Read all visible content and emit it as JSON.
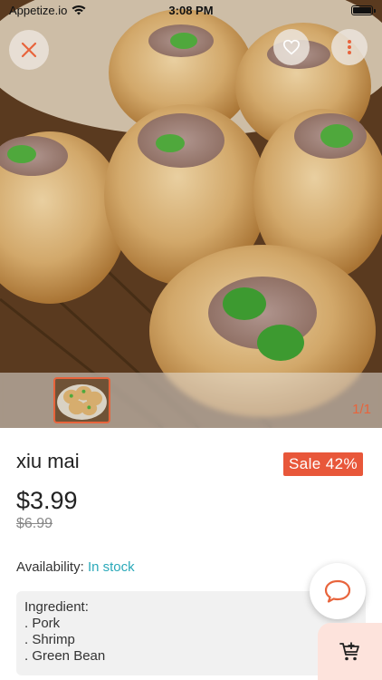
{
  "status_bar": {
    "carrier": "Appetize.io",
    "time": "3:08 PM"
  },
  "icons": {
    "close": "close-icon",
    "favorite": "heart-icon",
    "more": "more-vertical-icon",
    "chat": "chat-bubble-icon",
    "cart": "add-to-cart-icon",
    "wifi": "wifi-icon",
    "battery": "battery-icon"
  },
  "gallery": {
    "counter": "1/1"
  },
  "product": {
    "name": "xiu mai",
    "sale_badge": "Sale 42%",
    "price": "$3.99",
    "old_price": "$6.99",
    "availability_label": "Availability:",
    "availability_value": "In stock",
    "ingredients": {
      "heading": "Ingredient:",
      "items": [
        ". Pork",
        ". Shrimp",
        ". Green Bean"
      ]
    }
  },
  "colors": {
    "accent": "#e8643c",
    "sale": "#e8573a",
    "stock": "#2aa9b9",
    "cart_bg": "#fde3dc"
  }
}
